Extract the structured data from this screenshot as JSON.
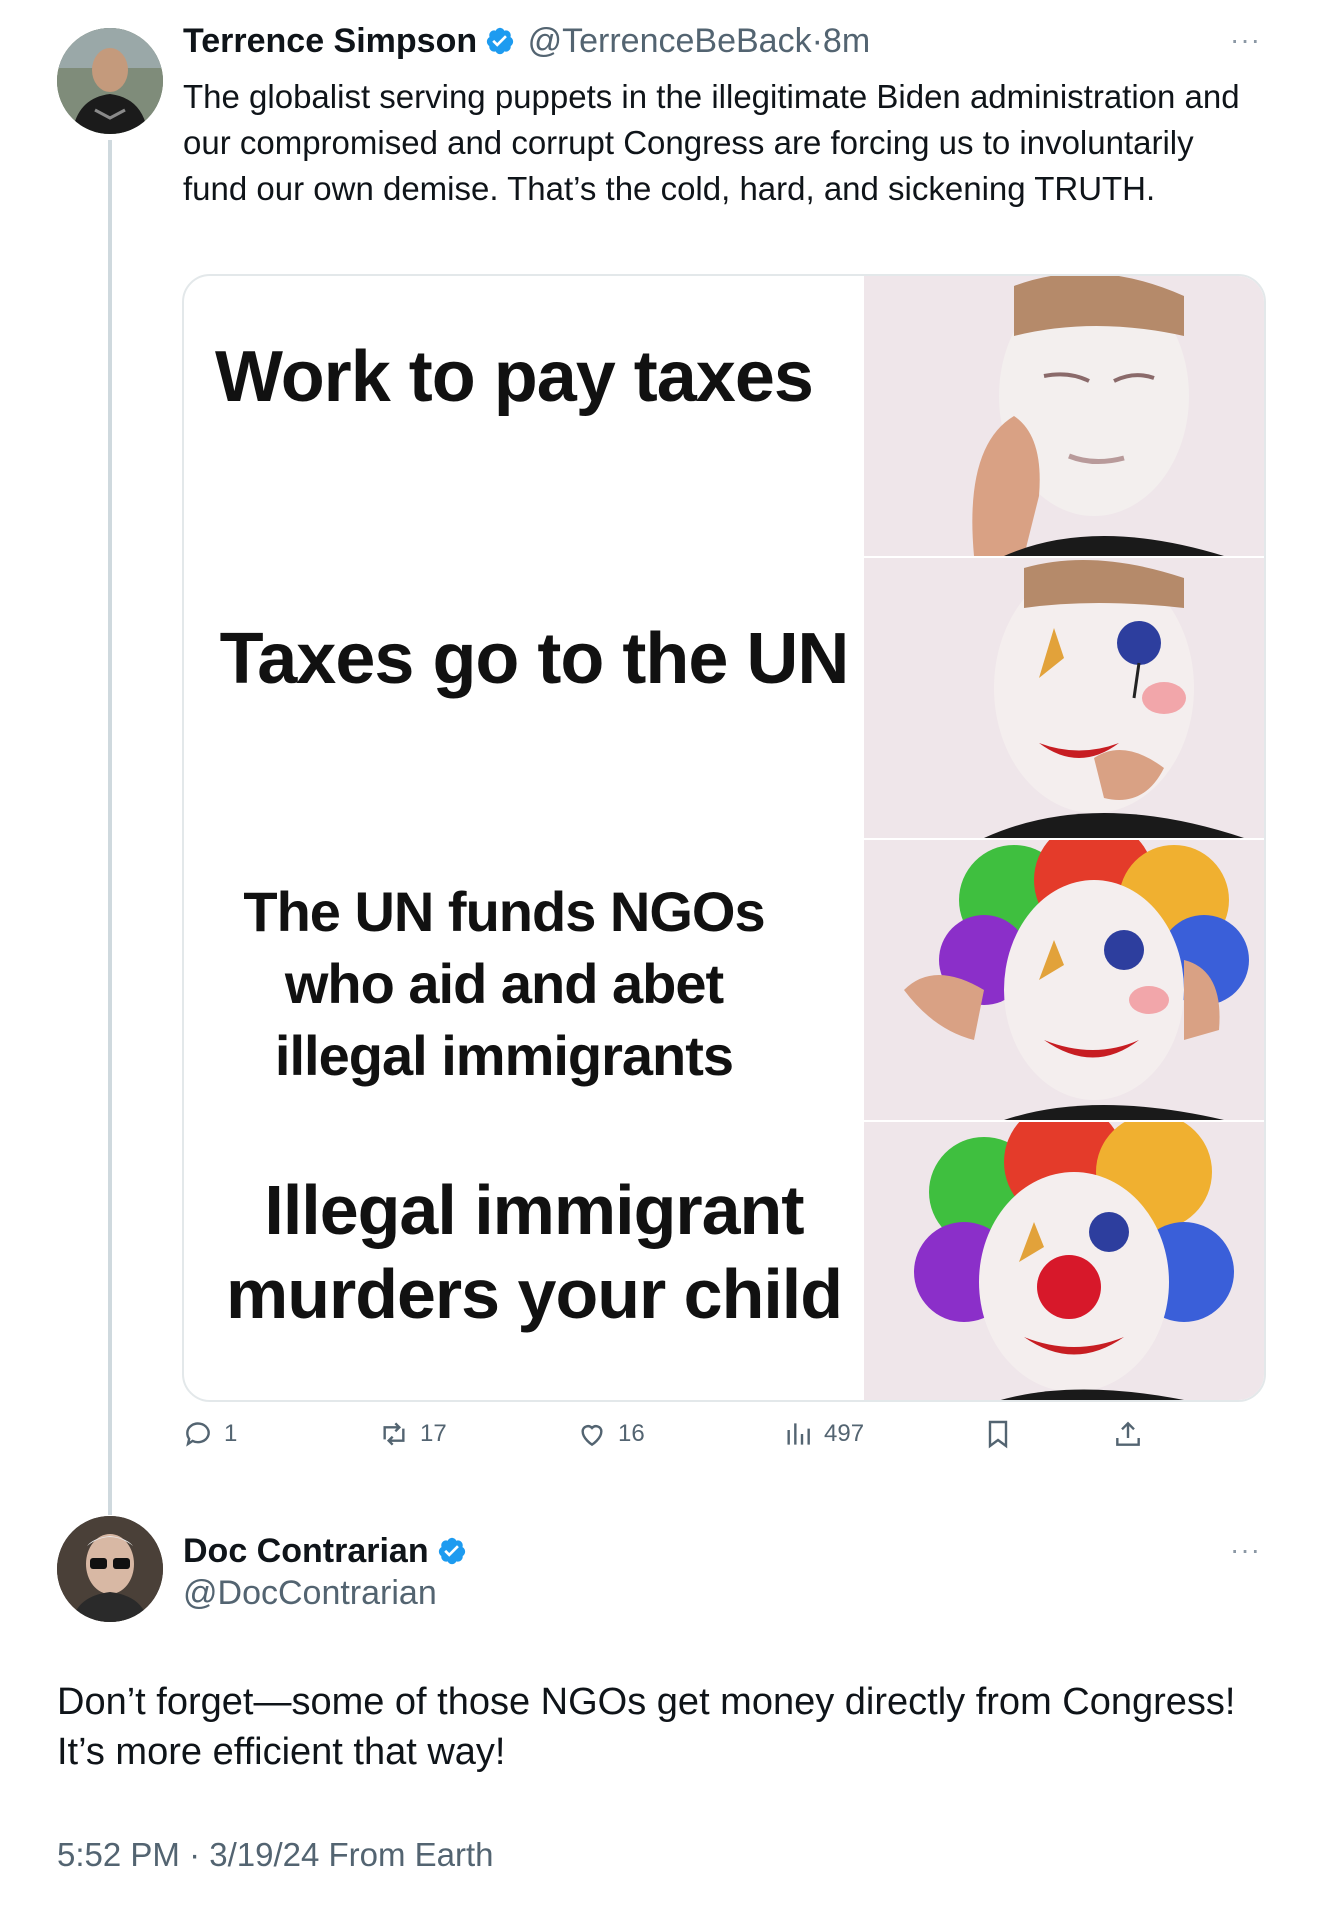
{
  "tweet1": {
    "author_name": "Terrence Simpson",
    "handle": "@TerrenceBeBack",
    "separator": "·",
    "time": "8m",
    "more": "···",
    "text": "The globalist serving puppets in the illegitimate Biden administration and our compromised and corrupt Congress are forcing us to involuntarily fund our own demise. That’s the cold, hard, and sickening TRUTH.",
    "meme": {
      "panel1": "Work to pay taxes",
      "panel2": "Taxes go to the UN",
      "panel3_line1": "The UN funds NGOs",
      "panel3_line2": "who aid and abet",
      "panel3_line3": "illegal immigrants",
      "panel4_line1": "Illegal immigrant",
      "panel4_line2": "murders your child"
    },
    "actions": {
      "replies": "1",
      "reposts": "17",
      "likes": "16",
      "views": "497"
    }
  },
  "tweet2": {
    "author_name": "Doc Contrarian",
    "handle": "@DocContrarian",
    "more": "···",
    "text": "Don’t forget—some of those NGOs get money directly from Congress! It’s more efficient that way!",
    "timestamp": "5:52 PM · 3/19/24 From Earth"
  },
  "colors": {
    "verified": "#1d9bf0",
    "secondary_text": "#536471",
    "thread_line": "#cfd9de"
  }
}
